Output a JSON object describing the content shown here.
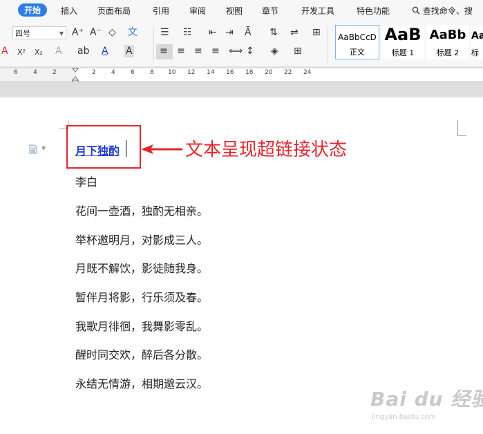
{
  "menubar": {
    "tabs": [
      "开始",
      "插入",
      "页面布局",
      "引用",
      "审阅",
      "视图",
      "章节",
      "开发工具",
      "特色功能"
    ],
    "active_tab": "开始",
    "search_label": "查找命令、搜"
  },
  "toolbar": {
    "font_size_value": "四号",
    "glyphs": {
      "grow_font": "A⁺",
      "shrink_font": "A⁻",
      "superscript": "X²",
      "subscript": "X₂",
      "font_color": "A",
      "char_shading": "A",
      "pinyin": "文"
    }
  },
  "styles": [
    {
      "preview": "AaBbCcD",
      "name": "正文"
    },
    {
      "preview": "AaB",
      "name": "标题 1"
    },
    {
      "preview": "AaBb",
      "name": "标题 2"
    },
    {
      "preview": "Aa",
      "name": "标"
    }
  ],
  "ruler": {
    "numbers": [
      "6",
      "4",
      "2",
      "2",
      "4",
      "6",
      "8",
      "10",
      "12",
      "14",
      "16",
      "18",
      "20",
      "22",
      "24"
    ]
  },
  "document": {
    "title_link": "月下独酌",
    "author": "李白",
    "lines": [
      "花间一壶酒，独酌无相亲。",
      "举杯邀明月，对影成三人。",
      "月既不解饮，影徒随我身。",
      "暂伴月将影，行乐须及春。",
      "我歌月徘徊，我舞影零乱。",
      "醒时同交欢，醉后各分散。",
      "永结无情游，相期邈云汉。"
    ]
  },
  "annotation": {
    "text": "文本呈现超链接状态",
    "color": "#e6252b"
  },
  "watermark": {
    "main": "Bai du 经验",
    "sub": "jingyan.baidu.com"
  },
  "colors": {
    "accent": "#2b7de9",
    "link": "#1a38d6",
    "annotation_red": "#e6252b"
  }
}
